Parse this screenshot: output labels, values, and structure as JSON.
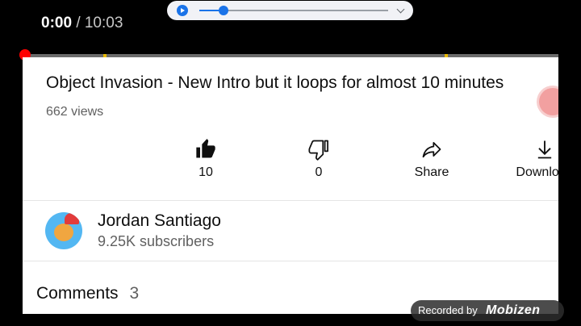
{
  "player": {
    "current_time": "0:00",
    "duration": "/ 10:03",
    "progress_fraction": 0
  },
  "media_pill": {
    "play_icon": "play-circle-icon",
    "expand_icon": "chevron-down-icon"
  },
  "video": {
    "title": "Object Invasion - New Intro but it loops for almost 10 minutes",
    "views": "662 views"
  },
  "actions": [
    {
      "icon": "like-icon",
      "label": "10"
    },
    {
      "icon": "dislike-icon",
      "label": "0"
    },
    {
      "icon": "share-icon",
      "label": "Share"
    },
    {
      "icon": "download-icon",
      "label": "Download"
    }
  ],
  "channel": {
    "name": "Jordan Santiago",
    "subscribers": "9.25K subscribers"
  },
  "comments": {
    "label": "Comments",
    "count": "3"
  },
  "watermark": {
    "label": "Recorded by",
    "brand": "Mobizen"
  },
  "colors": {
    "progress_played": "#ff0000",
    "chapter_marker": "#e6b800",
    "accent_blue": "#1a73e8"
  }
}
